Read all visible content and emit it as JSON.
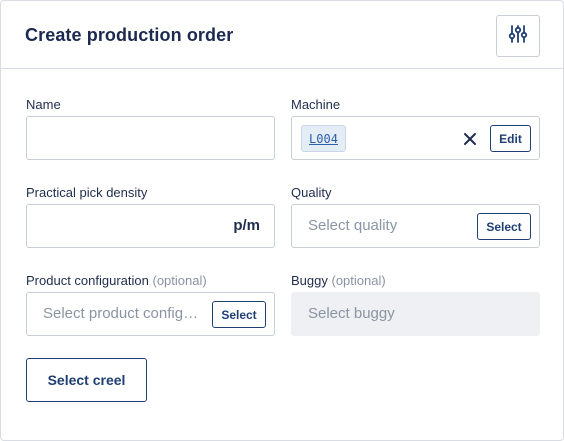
{
  "header": {
    "title": "Create production order",
    "settings_icon": "sliders-icon"
  },
  "fields": {
    "name": {
      "label": "Name",
      "value": ""
    },
    "machine": {
      "label": "Machine",
      "value": "L004",
      "edit_label": "Edit",
      "clear_icon": "close-icon"
    },
    "pick_density": {
      "label": "Practical pick density",
      "value": "",
      "unit": "p/m"
    },
    "quality": {
      "label": "Quality",
      "placeholder": "Select quality",
      "select_label": "Select"
    },
    "product_configuration": {
      "label": "Product configuration",
      "optional": "(optional)",
      "placeholder": "Select product configuration",
      "select_label": "Select"
    },
    "buggy": {
      "label": "Buggy",
      "optional": "(optional)",
      "placeholder": "Select buggy"
    }
  },
  "actions": {
    "select_creel_label": "Select creel"
  },
  "colors": {
    "accent": "#1f3f73",
    "border": "#c9ced6",
    "muted": "#8a94a3",
    "disabled_bg": "#eef0f3"
  }
}
